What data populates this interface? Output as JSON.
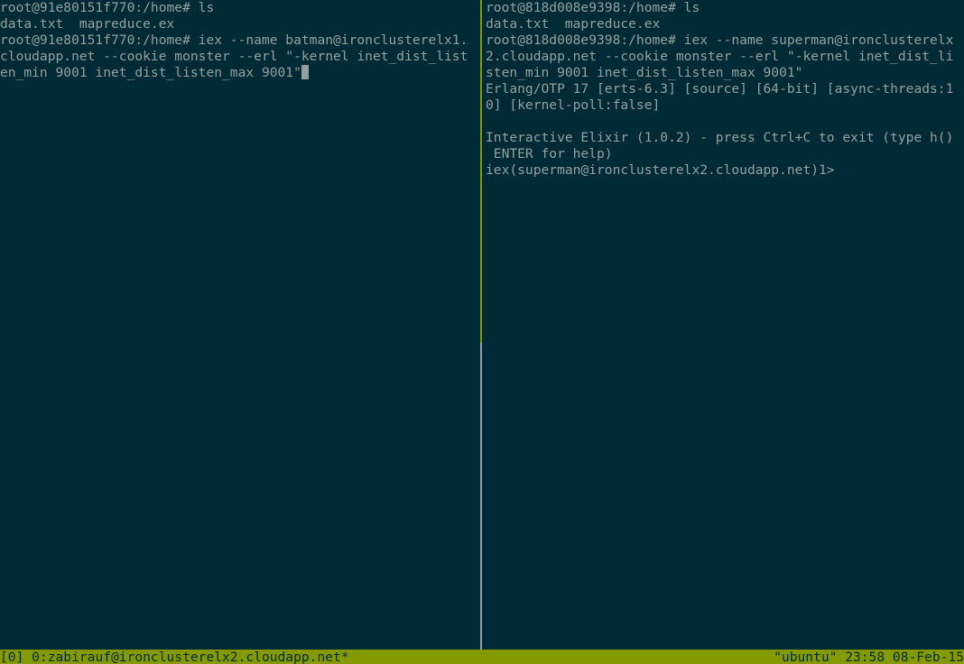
{
  "left_pane": {
    "lines": [
      "root@91e80151f770:/home# ls",
      "data.txt  mapreduce.ex",
      "root@91e80151f770:/home# iex --name batman@ironclusterelx1.",
      "cloudapp.net --cookie monster --erl \"-kernel inet_dist_list",
      "en_min 9001 inet_dist_listen_max 9001\""
    ]
  },
  "right_pane": {
    "lines": [
      "root@818d008e9398:/home# ls",
      "data.txt  mapreduce.ex",
      "root@818d008e9398:/home# iex --name superman@ironclusterelx",
      "2.cloudapp.net --cookie monster --erl \"-kernel inet_dist_li",
      "sten_min 9001 inet_dist_listen_max 9001\"",
      "Erlang/OTP 17 [erts-6.3] [source] [64-bit] [async-threads:1",
      "0] [kernel-poll:false]",
      "",
      "Interactive Elixir (1.0.2) - press Ctrl+C to exit (type h()",
      " ENTER for help)",
      "iex(superman@ironclusterelx2.cloudapp.net)1>"
    ]
  },
  "status_bar": {
    "left": "[0] 0:zabirauf@ironclusterelx2.cloudapp.net*",
    "right": "\"ubuntu\" 23:58 08-Feb-15"
  },
  "colors": {
    "background": "#002b36",
    "foreground": "#93a1a1",
    "status_bar": "#859900",
    "active_border": "#859900"
  }
}
